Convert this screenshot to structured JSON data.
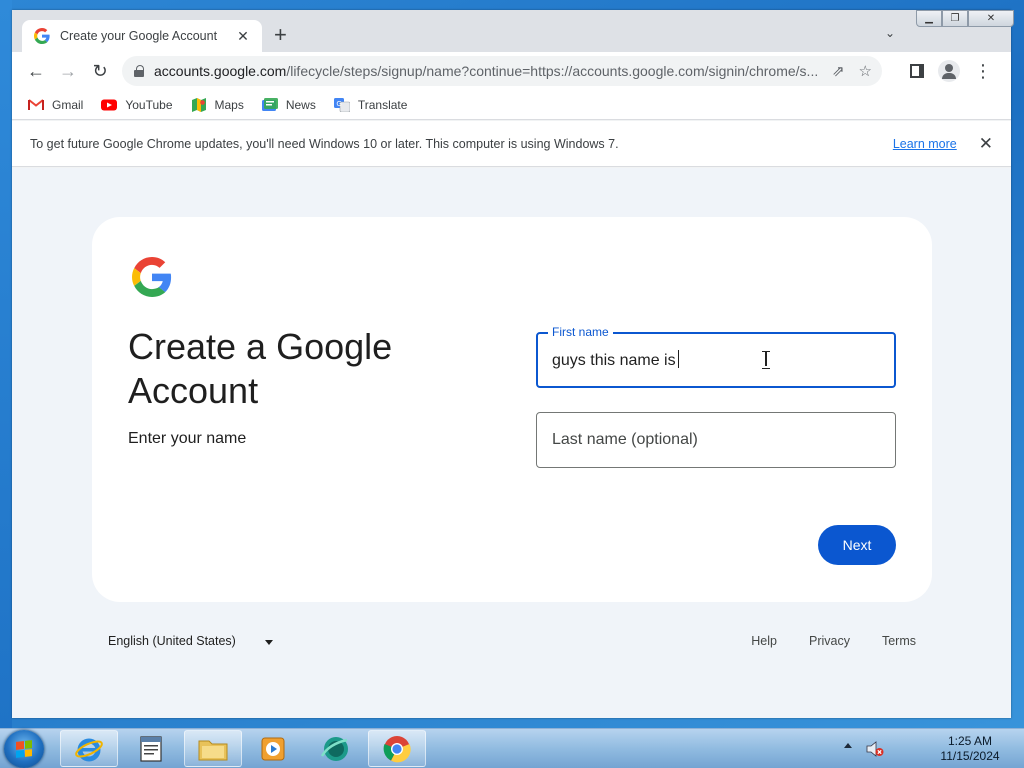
{
  "browser": {
    "tab": {
      "title": "Create your Google Account"
    },
    "url": {
      "host": "accounts.google.com",
      "path": "/lifecycle/steps/signup/name?continue=https://accounts.google.com/signin/chrome/s..."
    },
    "bookmarks": [
      {
        "label": "Gmail",
        "icon": "gmail-icon"
      },
      {
        "label": "YouTube",
        "icon": "youtube-icon"
      },
      {
        "label": "Maps",
        "icon": "maps-icon"
      },
      {
        "label": "News",
        "icon": "news-icon"
      },
      {
        "label": "Translate",
        "icon": "translate-icon"
      }
    ],
    "infobar": {
      "message": "To get future Google Chrome updates, you'll need Windows 10 or later. This computer is using Windows 7.",
      "link": "Learn more"
    }
  },
  "signup": {
    "title": "Create a Google Account",
    "subtitle": "Enter your name",
    "first_name": {
      "label": "First name",
      "value": "guys this name is"
    },
    "last_name": {
      "placeholder": "Last name (optional)"
    },
    "next_label": "Next"
  },
  "footer": {
    "language": "English (United States)",
    "links": [
      "Help",
      "Privacy",
      "Terms"
    ]
  },
  "taskbar": {
    "apps": [
      "internet-explorer-icon",
      "notepad-icon",
      "file-explorer-icon",
      "media-player-icon",
      "app-globe-icon",
      "chrome-icon"
    ],
    "time": "1:25 AM",
    "date": "11/15/2024"
  },
  "colors": {
    "accent": "#0b57d0",
    "link": "#1a73e8",
    "page_bg": "#f0f4f9"
  }
}
